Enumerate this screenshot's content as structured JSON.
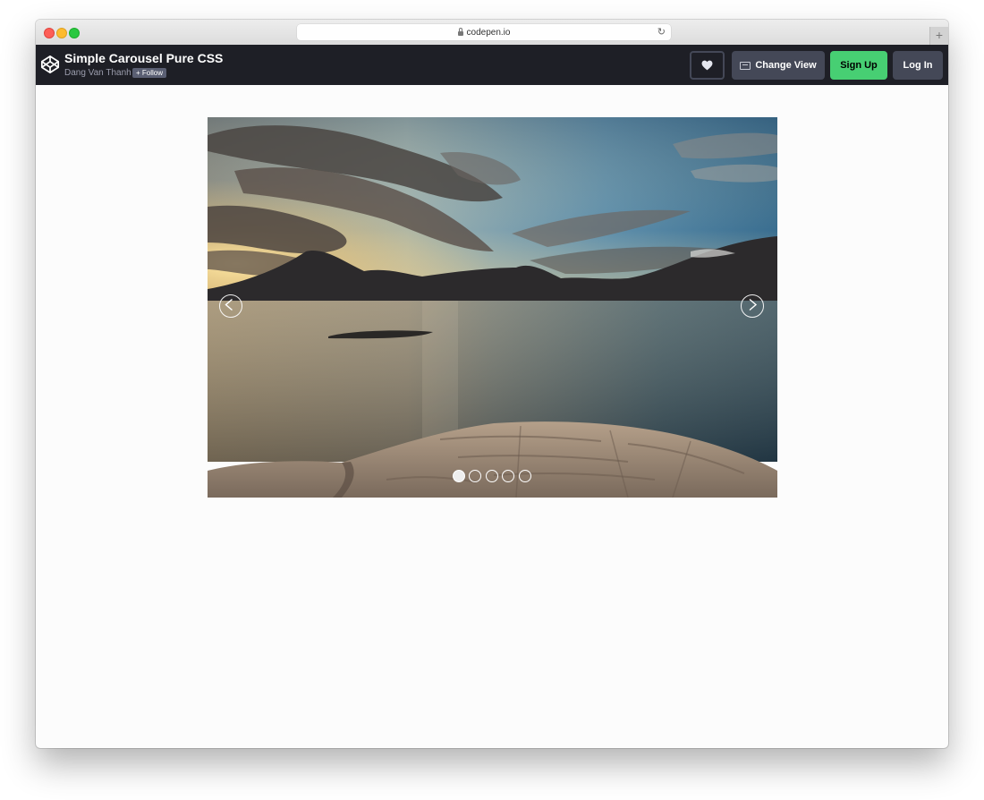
{
  "browser": {
    "url": "codepen.io",
    "lock_icon": "lock-icon",
    "reload_icon": "reload-icon",
    "newtab_icon": "plus-icon",
    "newtab_label": "+"
  },
  "header": {
    "title": "Simple Carousel Pure CSS",
    "author": "Dang Van Thanh",
    "follow_label": "+ Follow",
    "heart_icon": "heart-icon",
    "change_view_label": "Change View",
    "signup_label": "Sign Up",
    "login_label": "Log In",
    "colors": {
      "bar": "#1e1f26",
      "button": "#444857",
      "signup": "#47cf73"
    }
  },
  "carousel": {
    "prev_icon": "chevron-left-icon",
    "next_icon": "chevron-right-icon",
    "slide_count": 5,
    "active_index": 0
  }
}
